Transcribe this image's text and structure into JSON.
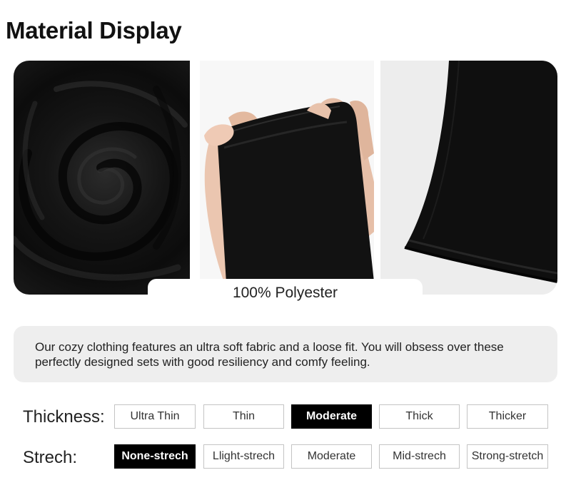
{
  "title": "Material Display",
  "material": "100% Polyester",
  "description": "Our cozy clothing features an ultra soft fabric and a loose fit. You will obsess over these perfectly designed sets with good resiliency and comfy feeling.",
  "photos": [
    "swirled-fabric-photo",
    "hand-stretching-fabric-photo",
    "garment-hem-photo"
  ],
  "thickness": {
    "label": "Thickness:",
    "options": [
      "Ultra Thin",
      "Thin",
      "Moderate",
      "Thick",
      "Thicker"
    ],
    "selected": "Moderate"
  },
  "stretch": {
    "label": "Strech:",
    "options": [
      "None-strech",
      "Llight-strech",
      "Moderate",
      "Mid-strech",
      "Strong-stretch"
    ],
    "selected": "None-strech"
  },
  "colors": {
    "selected_bg": "#000000",
    "panel_bg": "#eeeeee",
    "border": "#c4c4c4",
    "fabric": "#111111"
  }
}
